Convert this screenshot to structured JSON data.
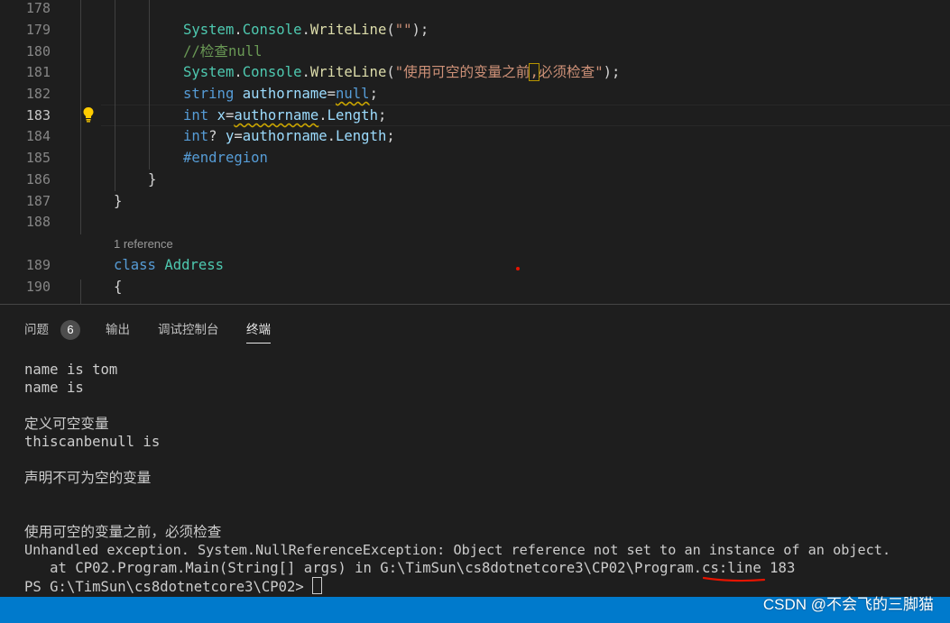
{
  "editor": {
    "line_numbers": [
      "178",
      "179",
      "180",
      "181",
      "182",
      "183",
      "184",
      "185",
      "186",
      "187",
      "188",
      "189",
      "190"
    ],
    "active_line": "183",
    "codelens": "1 reference",
    "tokens": {
      "l179": [
        "System",
        ".",
        "Console",
        ".",
        "WriteLine",
        "(",
        "\"\"",
        ");"
      ],
      "l180": [
        "//检查null"
      ],
      "l181": [
        "System",
        ".",
        "Console",
        ".",
        "WriteLine",
        "(",
        "\"使用可空的变量之前",
        ",",
        "必须检查\"",
        ");"
      ],
      "l182": [
        "string",
        " ",
        "authorname",
        "=",
        "null",
        ";"
      ],
      "l183": [
        "int",
        " ",
        "x",
        "=",
        "authorname",
        ".",
        "Length",
        ";"
      ],
      "l184": [
        "int",
        "?",
        " ",
        "y",
        "=",
        "authorname",
        ".",
        "Length",
        ";"
      ],
      "l185": [
        "#endregion"
      ],
      "l186": [
        "}"
      ],
      "l187": [
        "}"
      ],
      "l189": [
        "class",
        " ",
        "Address"
      ],
      "l190": [
        "{"
      ]
    },
    "colors": {
      "keyword": "#569cd6",
      "type": "#4ec9b0",
      "method": "#dcdcaa",
      "string": "#ce9178",
      "comment": "#6a9955",
      "variable": "#9cdcfe",
      "warning_squiggle": "#cca700"
    }
  },
  "panel": {
    "tabs": [
      {
        "label": "问题",
        "badge": "6"
      },
      {
        "label": "输出"
      },
      {
        "label": "调试控制台"
      },
      {
        "label": "终端",
        "active": true
      }
    ],
    "terminal_lines": [
      "name is tom",
      "name is",
      "",
      "定义可空变量",
      "thiscanbenull is",
      "",
      "声明不可为空的变量",
      "",
      "",
      "使用可空的变量之前，必须检查",
      "Unhandled exception. System.NullReferenceException: Object reference not set to an instance of an object.",
      "   at CP02.Program.Main(String[] args) in G:\\TimSun\\cs8dotnetcore3\\CP02\\Program.cs:line 183",
      "PS G:\\TimSun\\cs8dotnetcore3\\CP02> "
    ]
  },
  "statusbar": {
    "color": "#007acc"
  },
  "watermark": "CSDN @不会飞的三脚猫"
}
